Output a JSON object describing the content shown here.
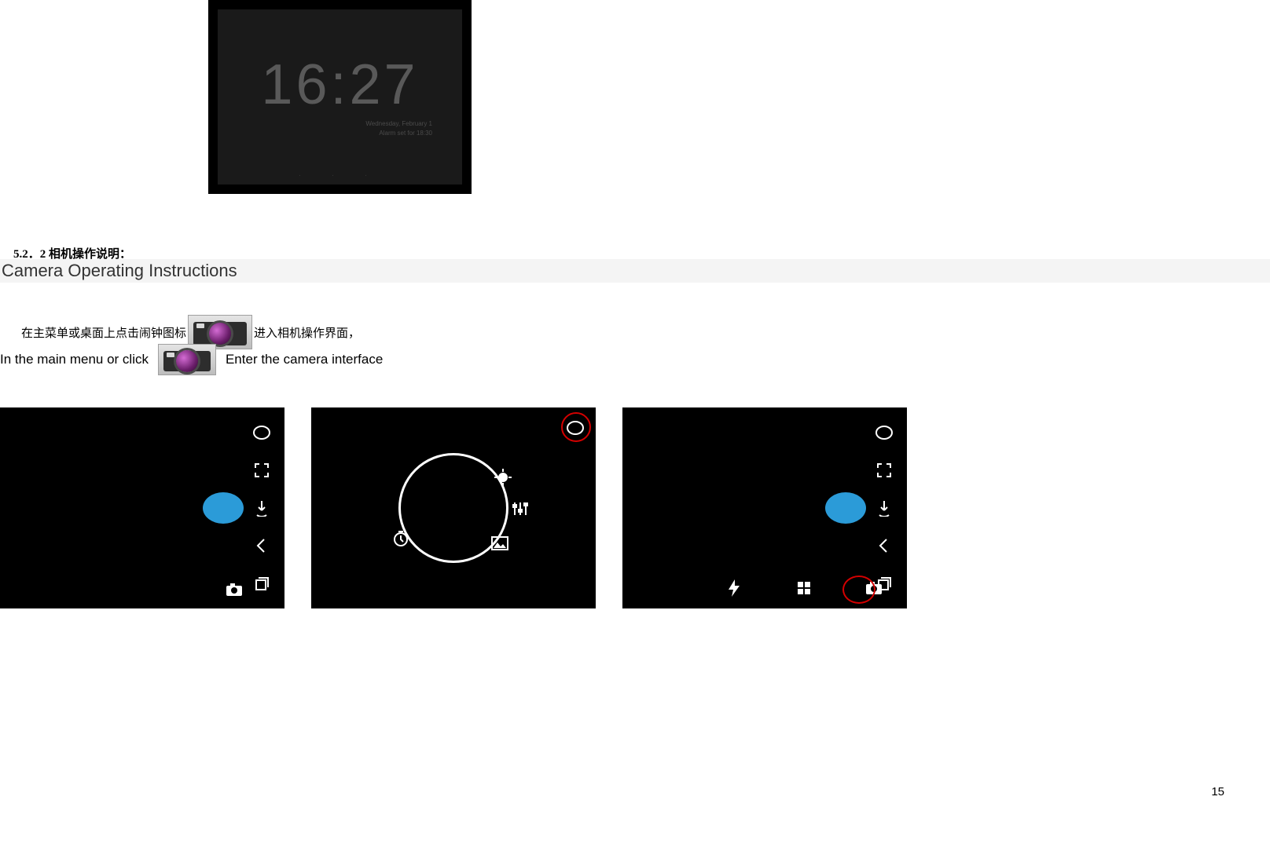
{
  "clock": {
    "time": "16:27",
    "day": "Wednesday, February 1",
    "alarm": "Alarm set for 18:30"
  },
  "section": {
    "number_title_cn": "5.2．2  相机操作说明：",
    "title_en": "Camera Operating Instructions"
  },
  "instruction_cn": {
    "before": "在主菜单或桌面上点击闹钟图标",
    "after": "进入相机操作界面，"
  },
  "instruction_en": {
    "before": "In the main menu or click",
    "after": "Enter the camera interface"
  },
  "icons": {
    "thumbnail": "thumbnail-icon",
    "fullscreen": "fullscreen-icon",
    "switch_cam": "switch-camera-icon",
    "back": "back-icon",
    "stack": "stack-icon",
    "exposure": "exposure-icon",
    "settings": "settings-sliders-icon",
    "scene": "scene-icon",
    "timer": "timer-icon",
    "camera_mode": "camera-mode-icon",
    "flash": "flash-icon",
    "grid": "grid-icon"
  },
  "page_number": "15"
}
